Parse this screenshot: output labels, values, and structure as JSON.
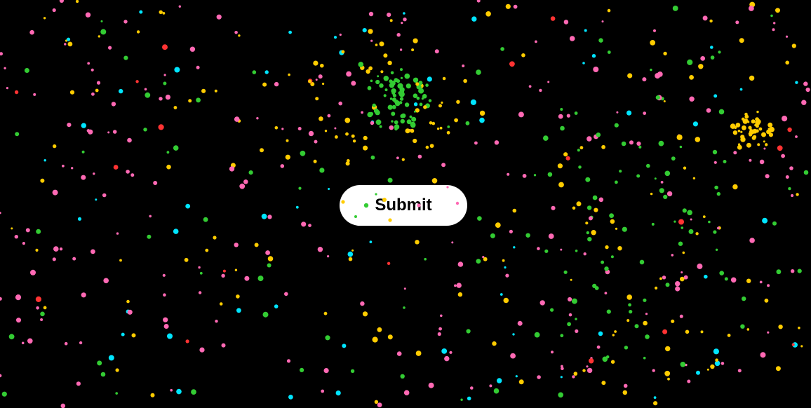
{
  "submit_button": {
    "label": "Submit"
  },
  "theme": {
    "background": "#000000",
    "button_background": "#ffffff",
    "button_text": "#000000"
  },
  "particle_colors": [
    "#ff69b4",
    "#ffcc00",
    "#33cc33",
    "#00e5ff",
    "#ff3333"
  ]
}
